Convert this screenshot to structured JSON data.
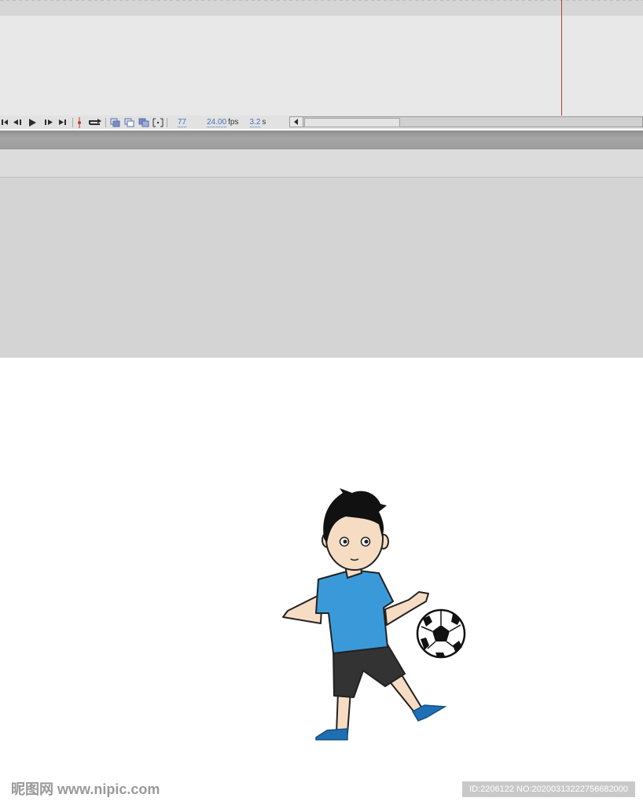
{
  "timeline": {
    "current_frame": "77",
    "frame_rate": "24.00",
    "frame_rate_unit": "fps",
    "elapsed_time": "3.2",
    "elapsed_time_unit": "s",
    "playhead_color": "#c0392b"
  },
  "controls": {
    "icons": [
      "rewind-to-first-icon",
      "step-back-icon",
      "play-icon",
      "step-forward-icon",
      "go-to-last-icon",
      "center-frame-icon",
      "loop-icon",
      "onion-skin-icon",
      "onion-skin-outlines-icon",
      "edit-multiple-frames-icon",
      "modify-markers-icon"
    ],
    "scroll_left_icon": "scroll-left-arrow-icon"
  },
  "stage": {
    "illustration": "boy-kicking-soccer-ball",
    "shirt_color": "#3a9ad9",
    "shorts_color": "#333333",
    "shoe_color": "#1f6fb5"
  },
  "watermark": {
    "left_text": "昵图网 www.nipic.com",
    "right_text": "ID:2206122 NO:20200313222756682000"
  }
}
